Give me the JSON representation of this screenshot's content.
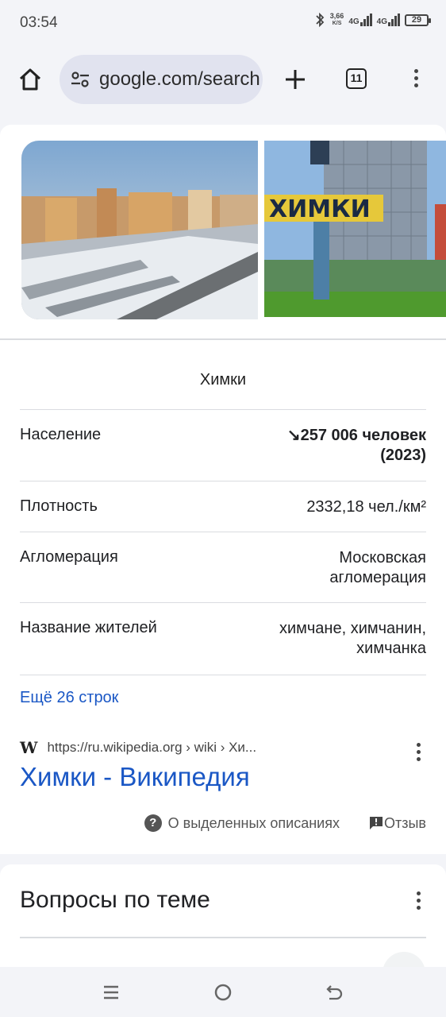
{
  "status": {
    "time": "03:54",
    "speed": "3,66",
    "speed_unit": "K/S",
    "net1": "4G",
    "net2": "4G",
    "battery": "29"
  },
  "browser": {
    "url": "google.com/search",
    "tabs_count": "11"
  },
  "knowledge_panel": {
    "title": "Химки",
    "rows": [
      {
        "label": "Население",
        "value_line1": "↘257 006 человек",
        "value_line2": "(2023)"
      },
      {
        "label": "Плотность",
        "value_line1": "2332,18 чел./км²",
        "value_line2": ""
      },
      {
        "label": "Агломерация",
        "value_line1": "Московская",
        "value_line2": "агломерация"
      },
      {
        "label": "Название жителей",
        "value_line1": "химчане, химчанин,",
        "value_line2": "химчанка"
      }
    ],
    "more_link": "Ещё 26 строк",
    "source_icon": "W",
    "source_url": "https://ru.wikipedia.org › wiki › Хи...",
    "source_title": "Химки - Википедия",
    "about_label": "О выделенных описаниях",
    "feedback_label": "Отзыв",
    "image2_sign": "ХИМКИ"
  },
  "related": {
    "title": "Вопросы по теме"
  }
}
